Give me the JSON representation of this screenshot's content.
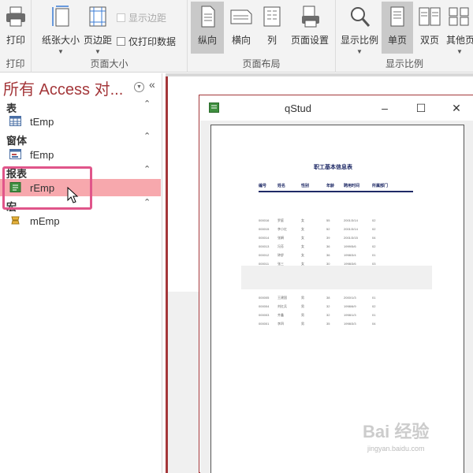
{
  "ribbon": {
    "print_group": {
      "label": "打印",
      "button": "打印"
    },
    "page_size_group": {
      "label": "页面大小",
      "paper_size": "纸张大小",
      "margins": "页边距",
      "show_margins": "显示边距",
      "print_data_only": "仅打印数据"
    },
    "page_layout_group": {
      "label": "页面布局",
      "portrait": "纵向",
      "landscape": "横向",
      "columns": "列",
      "page_setup": "页面设置"
    },
    "zoom_group": {
      "label": "显示比例",
      "zoom": "显示比例",
      "one_page": "单页",
      "two_pages": "双页",
      "more_pages": "其他页"
    }
  },
  "nav": {
    "title": "所有 Access 对...",
    "sections": [
      {
        "name": "表",
        "items": [
          {
            "label": "tEmp"
          }
        ]
      },
      {
        "name": "窗体",
        "items": [
          {
            "label": "fEmp"
          }
        ]
      },
      {
        "name": "报表",
        "items": [
          {
            "label": "rEmp"
          }
        ]
      },
      {
        "name": "宏",
        "items": [
          {
            "label": "mEmp"
          }
        ]
      }
    ]
  },
  "preview": {
    "title": "qStud",
    "report": {
      "title": "职工基本信息表",
      "headers": [
        "编号",
        "姓名",
        "性别",
        "年龄",
        "聘用时间",
        "所属部门"
      ],
      "rows": [
        [
          "000016",
          "罗庭",
          "女",
          "55",
          "2001/3/14",
          "02"
        ],
        [
          "000015",
          "李小红",
          "女",
          "52",
          "2001/3/14",
          "02"
        ],
        [
          "000014",
          "张娟",
          "女",
          "39",
          "2001/3/15",
          "04"
        ],
        [
          "000013",
          "冯芳",
          "女",
          "36",
          "1999/5/6",
          "02"
        ],
        [
          "000012",
          "钟舒",
          "女",
          "36",
          "1998/3/4",
          "01"
        ],
        [
          "000011",
          "张三",
          "女",
          "30",
          "1998/3/6",
          "03"
        ],
        [
          "000005",
          "王建国",
          "男",
          "38",
          "2000/1/3",
          "01"
        ],
        [
          "000004",
          "刘红兵",
          "男",
          "32",
          "1998/6/9",
          "02"
        ],
        [
          "000003",
          "齐鑫",
          "男",
          "32",
          "1998/1/3",
          "01"
        ],
        [
          "000001",
          "李四",
          "男",
          "35",
          "1998/3/3",
          "04"
        ]
      ]
    }
  },
  "watermark": {
    "main": "Bai 经验",
    "sub": "jingyan.baidu.com"
  },
  "colors": {
    "accent": "#a4373a",
    "selection": "#f7a8ad",
    "callout": "#e0558a",
    "report_text": "#1f2a66"
  }
}
